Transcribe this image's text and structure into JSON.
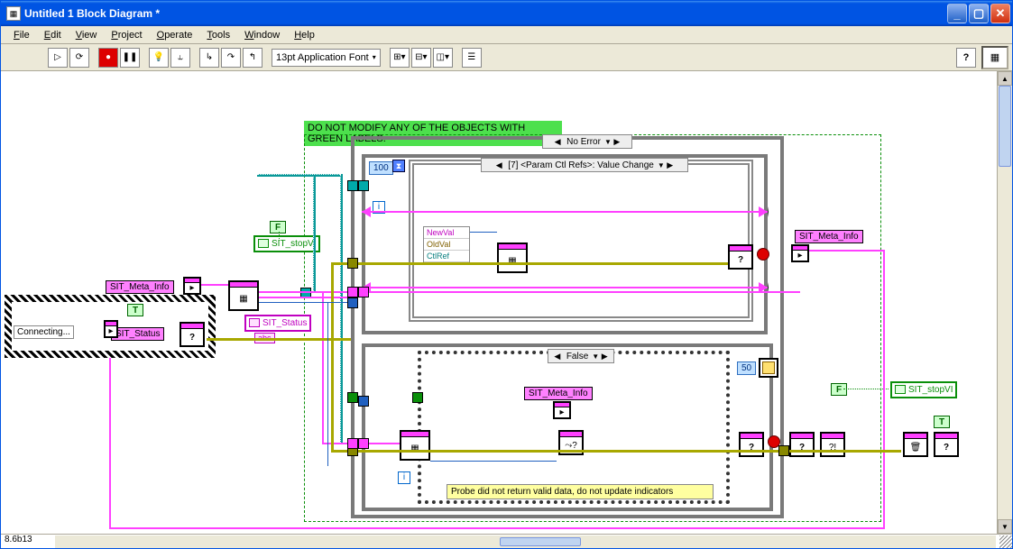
{
  "window": {
    "title": "Untitled 1 Block Diagram *"
  },
  "menu": {
    "file": "File",
    "edit": "Edit",
    "view": "View",
    "project": "Project",
    "operate": "Operate",
    "tools": "Tools",
    "window": "Window",
    "help": "Help"
  },
  "toolbar": {
    "font": "13pt Application Font"
  },
  "banner": "DO NOT MODIFY ANY OF THE OBJECTS WITH GREEN LABELS.",
  "case_outer": "No Error",
  "event_label": "[7] <Param Ctl Refs>: Value Change",
  "loop_n": "100",
  "unbundle": {
    "newval": "NewVal",
    "oldval": "OldVal",
    "ctlref": "CtlRef"
  },
  "case_lower": "False",
  "wait_ms": "50",
  "labels": {
    "connecting": "Connecting...",
    "sit_status_1": "SIT_Status",
    "sit_status_2": "SIT_Status",
    "sit_meta_info_1": "SIT_Meta_Info",
    "sit_meta_info_2": "SIT_Meta_Info",
    "sit_meta_info_3": "SIT_Meta_Info",
    "sit_stopvi_1": "SIT_stopVI",
    "sit_stopvi_2": "SIT_stopVI",
    "probe_msg": "Probe did not return valid data, do not update indicators",
    "abc": "abc"
  },
  "bools": {
    "t": "T",
    "f": "F"
  },
  "error_q": "?",
  "status": {
    "version": "8.6b13"
  },
  "idx": "i"
}
